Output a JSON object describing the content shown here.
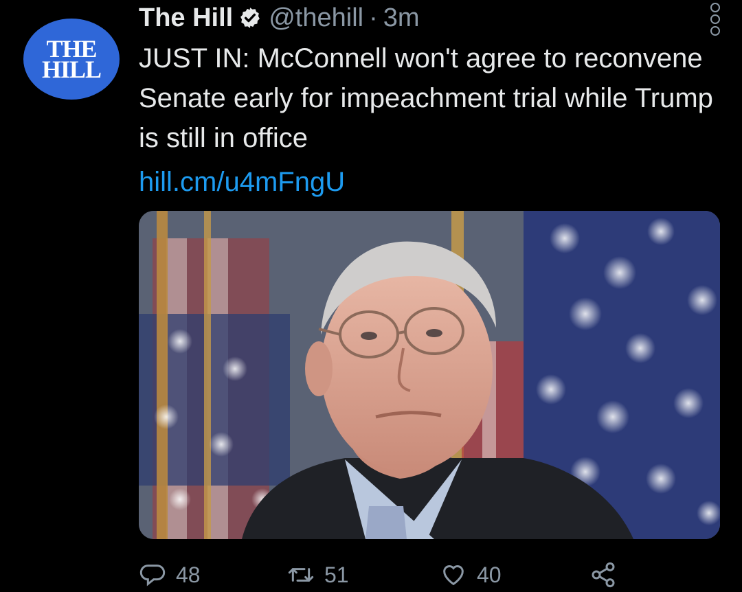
{
  "tweet": {
    "author": {
      "name": "The Hill",
      "handle": "@thehill",
      "time": "3m",
      "separator": "·",
      "avatar_lines": [
        "THE",
        "HILL"
      ],
      "verified_icon": "verified-badge-icon"
    },
    "text": "JUST IN: McConnell won't agree to reconvene Senate early for impeachment trial while Trump is still in office",
    "link": "hill.cm/u4mFngU",
    "media": {
      "type": "photo",
      "icon": "photo-icon"
    },
    "actions": {
      "reply_count": "48",
      "retweet_count": "51",
      "like_count": "40"
    }
  },
  "colors": {
    "background": "#000000",
    "text": "#e7e9ea",
    "secondary": "#8b98a5",
    "link": "#1d9bf0",
    "avatar": "#2f67d8"
  }
}
